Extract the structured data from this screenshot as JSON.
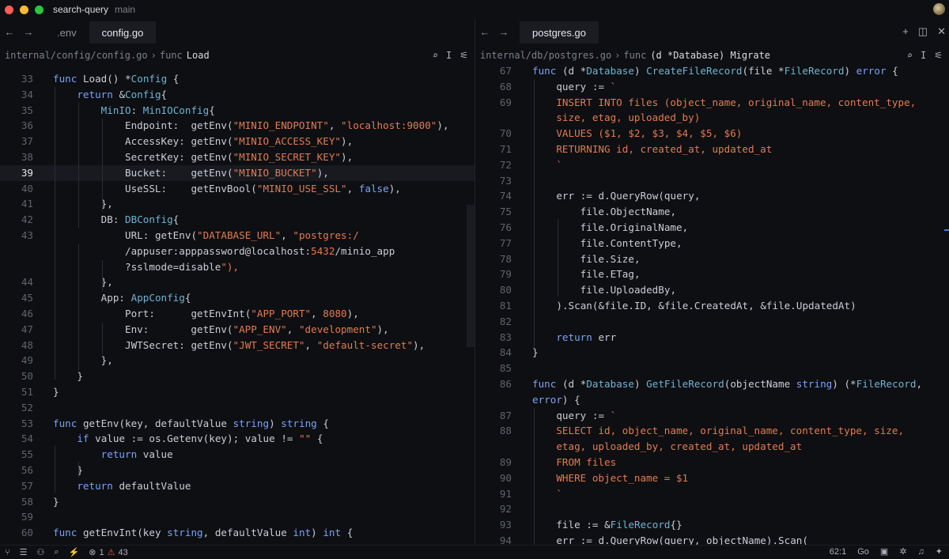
{
  "titlebar": {
    "project": "search-query",
    "branch": "main"
  },
  "left": {
    "nav_back": "←",
    "nav_forward": "→",
    "tabs": [
      {
        "label": ".env"
      },
      {
        "label": "config.go"
      }
    ],
    "breadcrumb": {
      "path": "internal/config/config.go",
      "sep": "›",
      "symbol_kw": "func",
      "symbol": "Load"
    },
    "search_icon": "⌕",
    "cursor_icon": "I",
    "settings_icon": "⚟",
    "lines": [
      {
        "n": "33",
        "text": "func Load() *Config {"
      },
      {
        "n": "34",
        "text": "    return &Config{"
      },
      {
        "n": "35",
        "text": "        MinIO: MinIOConfig{"
      },
      {
        "n": "36",
        "text": "            Endpoint:  getEnv(\"MINIO_ENDPOINT\", \"localhost:9000\"),"
      },
      {
        "n": "37",
        "text": "            AccessKey: getEnv(\"MINIO_ACCESS_KEY\"),"
      },
      {
        "n": "38",
        "text": "            SecretKey: getEnv(\"MINIO_SECRET_KEY\"),"
      },
      {
        "n": "39",
        "text": "            Bucket:    getEnv(\"MINIO_BUCKET\"),"
      },
      {
        "n": "40",
        "text": "            UseSSL:    getEnvBool(\"MINIO_USE_SSL\", false),"
      },
      {
        "n": "41",
        "text": "        },"
      },
      {
        "n": "42",
        "text": "        DB: DBConfig{"
      },
      {
        "n": "43",
        "text": "            URL: getEnv(\"DATABASE_URL\", \"postgres:/"
      },
      {
        "n": "",
        "text": "            /appuser:apppassword@localhost:5432/minio_app"
      },
      {
        "n": "",
        "text": "            ?sslmode=disable\"),"
      },
      {
        "n": "44",
        "text": "        },"
      },
      {
        "n": "45",
        "text": "        App: AppConfig{"
      },
      {
        "n": "46",
        "text": "            Port:      getEnvInt(\"APP_PORT\", 8080),"
      },
      {
        "n": "47",
        "text": "            Env:       getEnv(\"APP_ENV\", \"development\"),"
      },
      {
        "n": "48",
        "text": "            JWTSecret: getEnv(\"JWT_SECRET\", \"default-secret\"),"
      },
      {
        "n": "49",
        "text": "        },"
      },
      {
        "n": "50",
        "text": "    }"
      },
      {
        "n": "51",
        "text": "}"
      },
      {
        "n": "52",
        "text": ""
      },
      {
        "n": "53",
        "text": "func getEnv(key, defaultValue string) string {"
      },
      {
        "n": "54",
        "text": "    if value := os.Getenv(key); value != \"\" {"
      },
      {
        "n": "55",
        "text": "        return value"
      },
      {
        "n": "56",
        "text": "    }"
      },
      {
        "n": "57",
        "text": "    return defaultValue"
      },
      {
        "n": "58",
        "text": "}"
      },
      {
        "n": "59",
        "text": ""
      },
      {
        "n": "60",
        "text": "func getEnvInt(key string, defaultValue int) int {"
      }
    ]
  },
  "right": {
    "nav_back": "←",
    "nav_forward": "→",
    "tabs": [
      {
        "label": "postgres.go"
      }
    ],
    "breadcrumb": {
      "path": "internal/db/postgres.go",
      "sep": "›",
      "symbol_kw": "func",
      "symbol": "(d *Database) Migrate"
    },
    "search_icon": "⌕",
    "cursor_icon": "I",
    "settings_icon": "⚟",
    "new_icon": "+",
    "split_icon": "◫",
    "close_icon": "✕",
    "lines": [
      {
        "n": "67",
        "text": "func (d *Database) CreateFileRecord(file *FileRecord) error {"
      },
      {
        "n": "68",
        "text": "    query := `"
      },
      {
        "n": "69",
        "text": "    INSERT INTO files (object_name, original_name, content_type,"
      },
      {
        "n": "",
        "text": "    size, etag, uploaded_by)"
      },
      {
        "n": "70",
        "text": "    VALUES ($1, $2, $3, $4, $5, $6)"
      },
      {
        "n": "71",
        "text": "    RETURNING id, created_at, updated_at"
      },
      {
        "n": "72",
        "text": "    `"
      },
      {
        "n": "73",
        "text": ""
      },
      {
        "n": "74",
        "text": "    err := d.QueryRow(query,"
      },
      {
        "n": "75",
        "text": "        file.ObjectName,"
      },
      {
        "n": "76",
        "text": "        file.OriginalName,"
      },
      {
        "n": "77",
        "text": "        file.ContentType,"
      },
      {
        "n": "78",
        "text": "        file.Size,"
      },
      {
        "n": "79",
        "text": "        file.ETag,"
      },
      {
        "n": "80",
        "text": "        file.UploadedBy,"
      },
      {
        "n": "81",
        "text": "    ).Scan(&file.ID, &file.CreatedAt, &file.UpdatedAt)"
      },
      {
        "n": "82",
        "text": ""
      },
      {
        "n": "83",
        "text": "    return err"
      },
      {
        "n": "84",
        "text": "}"
      },
      {
        "n": "85",
        "text": ""
      },
      {
        "n": "86",
        "text": "func (d *Database) GetFileRecord(objectName string) (*FileRecord,"
      },
      {
        "n": "",
        "text": "error) {"
      },
      {
        "n": "87",
        "text": "    query := `"
      },
      {
        "n": "88",
        "text": "    SELECT id, object_name, original_name, content_type, size,"
      },
      {
        "n": "",
        "text": "    etag, uploaded_by, created_at, updated_at"
      },
      {
        "n": "89",
        "text": "    FROM files"
      },
      {
        "n": "90",
        "text": "    WHERE object_name = $1"
      },
      {
        "n": "91",
        "text": "    `"
      },
      {
        "n": "92",
        "text": ""
      },
      {
        "n": "93",
        "text": "    file := &FileRecord{}"
      },
      {
        "n": "94",
        "text": "    err := d.QueryRow(query, objectName).Scan("
      }
    ]
  },
  "statusbar": {
    "branch_icon": "⑂",
    "outline_icon": "☰",
    "collab_icon": "⚇",
    "search_icon": "⌕",
    "bolt_icon": "⚡",
    "errors": "1",
    "warnings": "43",
    "cursor_pos": "62:1",
    "language": "Go",
    "terminal_icon": "▣",
    "debug_icon": "✲",
    "bell_icon": "♫",
    "ai_icon": "✦"
  }
}
